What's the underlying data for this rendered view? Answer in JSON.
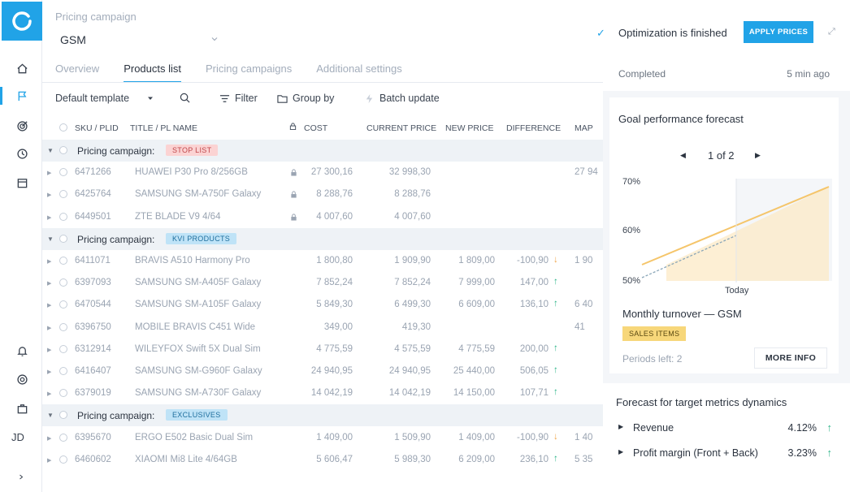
{
  "rail": {
    "initials": "JD",
    "icons": [
      "home-icon",
      "flag-icon",
      "target-icon",
      "clock-icon",
      "calendar-icon",
      "bell-icon",
      "support-icon",
      "briefcase-icon"
    ]
  },
  "header": {
    "campaign_label": "Pricing campaign",
    "campaign_value": "GSM"
  },
  "tabs": [
    {
      "label": "Overview",
      "active": false
    },
    {
      "label": "Products list",
      "active": true
    },
    {
      "label": "Pricing campaigns",
      "active": false
    },
    {
      "label": "Additional settings",
      "active": false
    }
  ],
  "toolbar": {
    "template": "Default template",
    "filter": "Filter",
    "group_by": "Group by",
    "batch_update": "Batch update"
  },
  "columns": {
    "sku": "SKU / PLID",
    "title": "TITLE / PL NAME",
    "cost": "COST",
    "current_price": "CURRENT PRICE",
    "new_price": "NEW PRICE",
    "difference": "DIFFERENCE",
    "map": "MAP"
  },
  "groups": [
    {
      "label": "Pricing campaign:",
      "tag": "STOP LIST",
      "tag_bg": "#fbd3d3",
      "tag_fg": "#c0474b",
      "rows": [
        {
          "sku": "6471266",
          "title": "HUAWEI P30 Pro 8/256GB",
          "lock": true,
          "cost": "27 300,16",
          "current": "32 998,30",
          "new": "",
          "diff": "",
          "dir": "",
          "map": "27 94"
        },
        {
          "sku": "6425764",
          "title": "SAMSUNG SM-A750F Galaxy",
          "lock": true,
          "cost": "8 288,76",
          "current": "8 288,76",
          "new": "",
          "diff": "",
          "dir": "",
          "map": ""
        },
        {
          "sku": "6449501",
          "title": "ZTE BLADE V9 4/64",
          "lock": true,
          "cost": "4 007,60",
          "current": "4 007,60",
          "new": "",
          "diff": "",
          "dir": "",
          "map": ""
        }
      ]
    },
    {
      "label": "Pricing campaign:",
      "tag": "KVI PRODUCTS",
      "tag_bg": "#bfe3f7",
      "tag_fg": "#1f6f9e",
      "rows": [
        {
          "sku": "6411071",
          "title": "BRAVIS A510 Harmony Pro",
          "lock": false,
          "cost": "1 800,80",
          "current": "1 909,90",
          "new": "1 809,00",
          "diff": "-100,90",
          "dir": "down",
          "map": "1 90"
        },
        {
          "sku": "6397093",
          "title": "SAMSUNG SM-A405F Galaxy",
          "lock": false,
          "cost": "7 852,24",
          "current": "7 852,24",
          "new": "7 999,00",
          "diff": "147,00",
          "dir": "up",
          "map": ""
        },
        {
          "sku": "6470544",
          "title": "SAMSUNG SM-A105F Galaxy",
          "lock": false,
          "cost": "5 849,30",
          "current": "6 499,30",
          "new": "6 609,00",
          "diff": "136,10",
          "dir": "up",
          "map": "6 40"
        },
        {
          "sku": "6396750",
          "title": "MOBILE BRAVIS C451 Wide",
          "lock": false,
          "cost": "349,00",
          "current": "419,30",
          "new": "",
          "diff": "",
          "dir": "",
          "map": "41"
        },
        {
          "sku": "6312914",
          "title": "WILEYFOX Swift 5X Dual Sim",
          "lock": false,
          "cost": "4 775,59",
          "current": "4 575,59",
          "new": "4 775,59",
          "diff": "200,00",
          "dir": "up",
          "map": ""
        },
        {
          "sku": "6416407",
          "title": "SAMSUNG SM-G960F Galaxy",
          "lock": false,
          "cost": "24 940,95",
          "current": "24 940,95",
          "new": "25 440,00",
          "diff": "506,05",
          "dir": "up",
          "map": ""
        },
        {
          "sku": "6379019",
          "title": "SAMSUNG SM-A730F Galaxy",
          "lock": false,
          "cost": "14 042,19",
          "current": "14 042,19",
          "new": "14 150,00",
          "diff": "107,71",
          "dir": "up",
          "map": ""
        }
      ]
    },
    {
      "label": "Pricing campaign:",
      "tag": "EXCLUSIVES",
      "tag_bg": "#bfe3f7",
      "tag_fg": "#1f6f9e",
      "rows": [
        {
          "sku": "6395670",
          "title": "ERGO E502 Basic Dual Sim",
          "lock": false,
          "cost": "1 409,00",
          "current": "1 509,90",
          "new": "1 409,00",
          "diff": "-100,90",
          "dir": "down",
          "map": "1 40"
        },
        {
          "sku": "6460602",
          "title": "XIAOMI Mi8 Lite 4/64GB",
          "lock": false,
          "cost": "5 606,47",
          "current": "5 989,30",
          "new": "6 209,00",
          "diff": "236,10",
          "dir": "up",
          "map": "5 35"
        }
      ]
    }
  ],
  "panel": {
    "opt_title": "Optimization is finished",
    "apply_label": "APPLY PRICES",
    "completed_label": "Completed",
    "completed_time": "5 min ago",
    "goal_title": "Goal performance forecast",
    "pager": "1 of 2",
    "y_labels": [
      "70%",
      "60%",
      "50%"
    ],
    "today_label": "Today",
    "turnover_title": "Monthly turnover — GSM",
    "sales_tag": "SALES ITEMS",
    "periods": "Periods left: 2",
    "more_info": "MORE INFO",
    "forecast_title": "Forecast for target metrics dynamics",
    "metrics": [
      {
        "name": "Revenue",
        "value": "4.12%"
      },
      {
        "name": "Profit margin (Front + Back)",
        "value": "3.23%"
      }
    ],
    "accent_color": "#21a3e7",
    "forecast_color": "#f5c56a"
  }
}
